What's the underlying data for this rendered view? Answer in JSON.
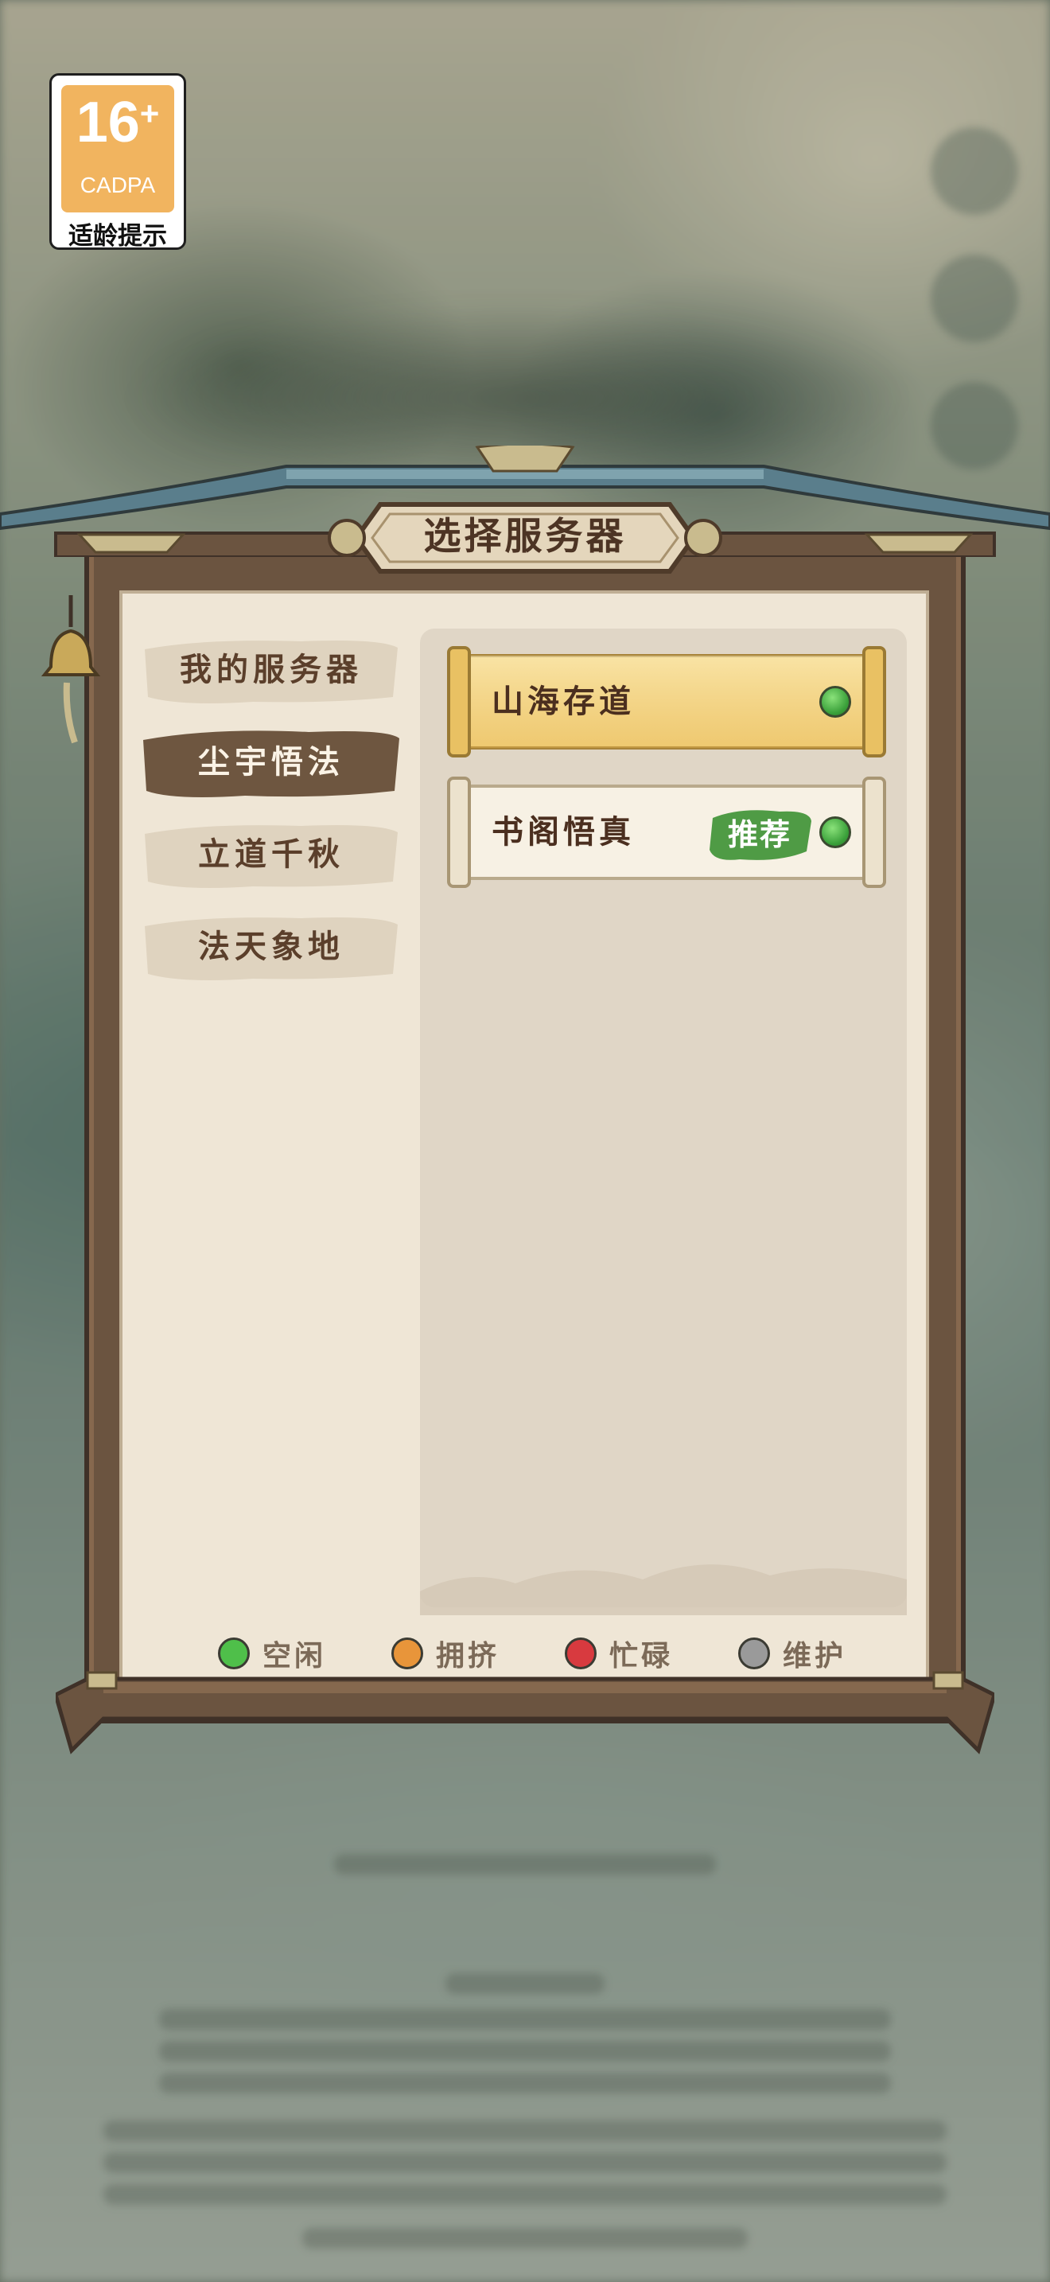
{
  "age_badge": {
    "number": "16",
    "plus": "+",
    "org": "CADPA",
    "tip": "适龄提示"
  },
  "dialog": {
    "title": "选择服务器"
  },
  "tabs": [
    {
      "label": "我的服务器",
      "active": false
    },
    {
      "label": "尘宇悟法",
      "active": true
    },
    {
      "label": "立道千秋",
      "active": false
    },
    {
      "label": "法天象地",
      "active": false
    }
  ],
  "servers": [
    {
      "name": "山海存道",
      "status": "idle",
      "selected": true
    },
    {
      "name": "书阁悟真",
      "status": "idle",
      "badge": "推荐",
      "selected": false
    }
  ],
  "legend": [
    {
      "label": "空闲",
      "color": "#4fbf4a"
    },
    {
      "label": "拥挤",
      "color": "#e8953a"
    },
    {
      "label": "忙碌",
      "color": "#d83a3f"
    },
    {
      "label": "维护",
      "color": "#9a9a9a"
    }
  ]
}
